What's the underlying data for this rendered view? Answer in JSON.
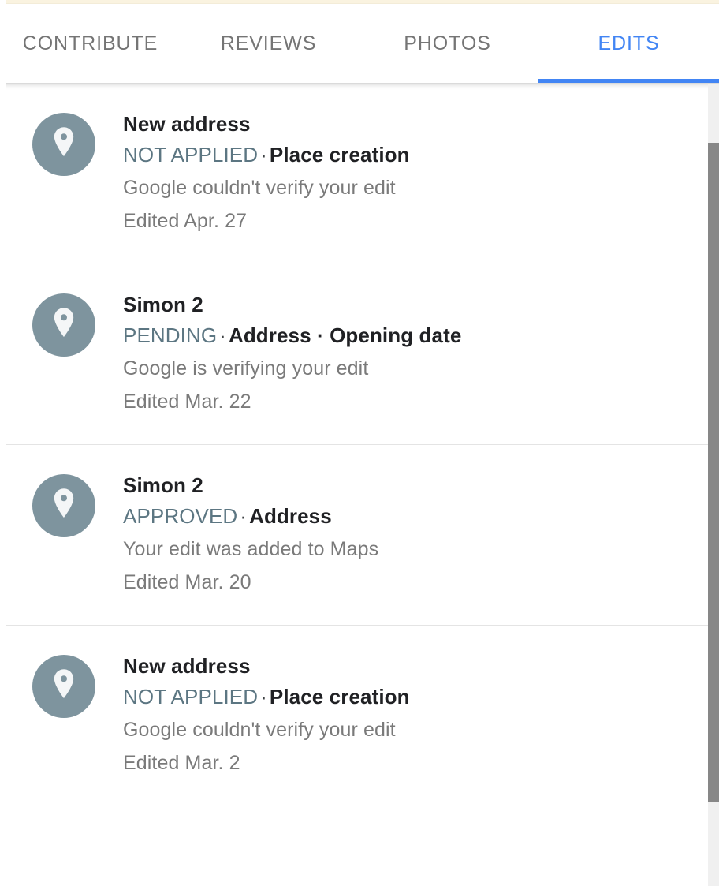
{
  "top_strip": {
    "color": "#faf3e0"
  },
  "colors": {
    "accent_blue": "#4285f4",
    "tab_inactive": "#757575",
    "avatar_bg": "#7e949e",
    "status_slate": "#5c7682",
    "secondary_gray": "#7a7a7a",
    "title_dark": "#202124",
    "divider": "#e4e4e4",
    "scrollbar_thumb": "#878787",
    "scrollbar_track": "#f0f0f0"
  },
  "tabs": {
    "items": [
      {
        "label": "CONTRIBUTE",
        "active": false
      },
      {
        "label": "REVIEWS",
        "active": false
      },
      {
        "label": "PHOTOS",
        "active": false
      },
      {
        "label": "EDITS",
        "active": true
      }
    ],
    "selected": "EDITS"
  },
  "edits": {
    "items": [
      {
        "icon": "map-pin-icon",
        "title": "New address",
        "status": "NOT APPLIED",
        "separator": "·",
        "kind": "Place creation",
        "note": "Google couldn't verify your edit",
        "date": "Edited Apr. 27"
      },
      {
        "icon": "map-pin-icon",
        "title": "Simon 2",
        "status": "PENDING",
        "separator": "·",
        "kind": "Address · Opening date",
        "note": "Google is verifying your edit",
        "date": "Edited Mar. 22"
      },
      {
        "icon": "map-pin-icon",
        "title": "Simon 2",
        "status": "APPROVED",
        "separator": "·",
        "kind": "Address",
        "note": "Your edit was added to Maps",
        "date": "Edited Mar. 20"
      },
      {
        "icon": "map-pin-icon",
        "title": "New address",
        "status": "NOT APPLIED",
        "separator": "·",
        "kind": "Place creation",
        "note": "Google couldn't verify your edit",
        "date": "Edited Mar. 2"
      }
    ]
  },
  "scrollbar": {
    "name": "vertical-scrollbar"
  }
}
